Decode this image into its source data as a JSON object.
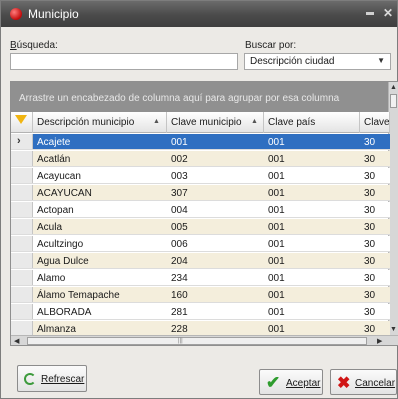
{
  "window": {
    "title": "Municipio"
  },
  "search": {
    "label_prefix_underlined": "B",
    "label_rest": "úsqueda:",
    "value": "",
    "placeholder": ""
  },
  "search_by": {
    "label": "Buscar por:",
    "selected": "Descripción ciudad"
  },
  "grid": {
    "group_hint": "Arrastre un encabezado de columna aquí para agrupar por esa columna",
    "columns": [
      {
        "label": "Descripción municipio",
        "sort": "▲"
      },
      {
        "label": "Clave municipio",
        "sort": "▲"
      },
      {
        "label": "Clave país",
        "sort": ""
      },
      {
        "label": "Clave",
        "sort": ""
      }
    ],
    "rows": [
      [
        "Acajete",
        "001",
        "001",
        "30"
      ],
      [
        "Acatlán",
        "002",
        "001",
        "30"
      ],
      [
        "Acayucan",
        "003",
        "001",
        "30"
      ],
      [
        "ACAYUCAN",
        "307",
        "001",
        "30"
      ],
      [
        "Actopan",
        "004",
        "001",
        "30"
      ],
      [
        "Acula",
        "005",
        "001",
        "30"
      ],
      [
        "Acultzingo",
        "006",
        "001",
        "30"
      ],
      [
        "Agua Dulce",
        "204",
        "001",
        "30"
      ],
      [
        "Alamo",
        "234",
        "001",
        "30"
      ],
      [
        "Álamo Temapache",
        "160",
        "001",
        "30"
      ],
      [
        "ALBORADA",
        "281",
        "001",
        "30"
      ],
      [
        "Almanza",
        "228",
        "001",
        "30"
      ]
    ],
    "selected_row": 0
  },
  "buttons": {
    "refresh": "Refrescar",
    "accept": "Aceptar",
    "cancel": "Cancelar"
  },
  "icons": {
    "window": "app-icon",
    "filter": "filter-icon",
    "refresh": "refresh-icon",
    "accept": "check-icon",
    "cancel": "x-icon"
  },
  "colors": {
    "titlebar": "#4a4a4a",
    "selection": "#2f6fc1",
    "alt_row": "#f4eedc",
    "group_panel": "#909090"
  }
}
